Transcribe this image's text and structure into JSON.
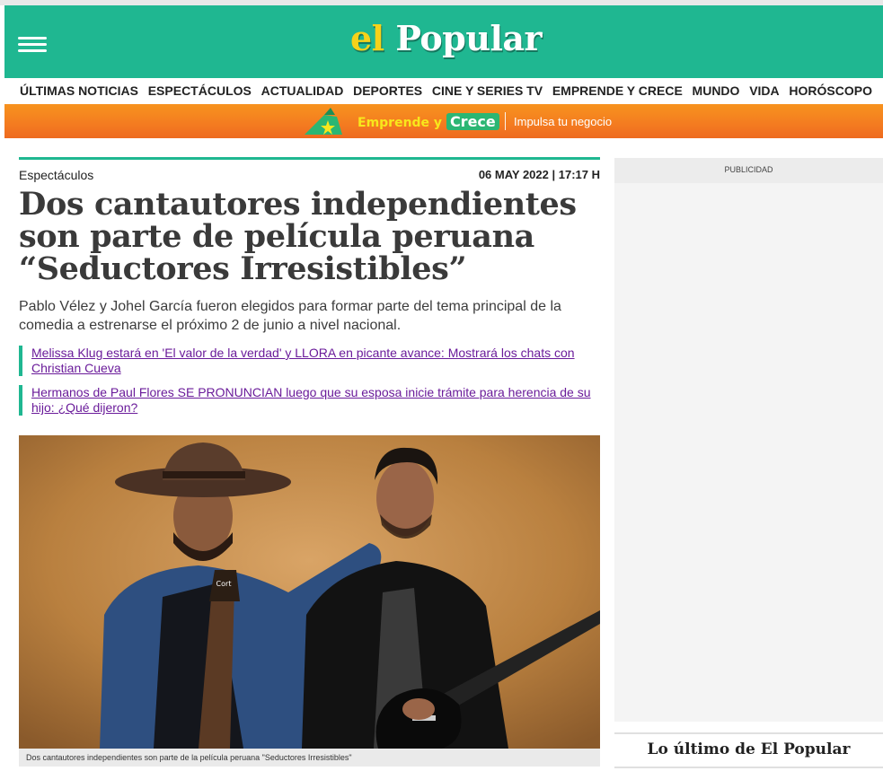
{
  "header": {
    "logo_el": "el",
    "logo_popular": "Popular",
    "menu_icon": "hamburger-menu-icon",
    "background_color": "#1fb791",
    "logo_accent_color": "#f6d21a"
  },
  "nav": {
    "items": [
      "ÚLTIMAS NOTICIAS",
      "ESPECTÁCULOS",
      "ACTUALIDAD",
      "DEPORTES",
      "CINE Y SERIES TV",
      "EMPRENDE Y CRECE",
      "MUNDO",
      "VIDA",
      "HORÓSCOPO"
    ]
  },
  "banner": {
    "brand_emprende": "Emprende y",
    "brand_crece": "Crece",
    "tagline": "Impulsa tu negocio",
    "icon": "megaphone-star-icon",
    "color": "#f47b20"
  },
  "article": {
    "section": "Espectáculos",
    "date": "06 MAY 2022 | 17:17 H",
    "title": "Dos cantautores independientes son parte de película peruana “Seductores Irresistibles”",
    "summary": "Pablo Vélez y Johel García fueron elegidos para formar parte del tema principal de la comedia a estrenarse el próximo 2 de junio a nivel nacional.",
    "related": [
      "Melissa Klug estará en 'El valor de la verdad' y LLORA en picante avance: Mostrará los chats con Christian Cueva",
      "Hermanos de Paul Flores SE PRONUNCIAN luego que su esposa inicie trámite para herencia de su hijo: ¿Qué dijeron?"
    ],
    "photo_caption": "Dos cantautores independientes son parte de la película peruana \"Seductores Irresistibles\"",
    "guitar_brand": "Cort"
  },
  "sidebar": {
    "ad_label": "PUBLICIDAD",
    "latest_title": "Lo último de El Popular"
  }
}
